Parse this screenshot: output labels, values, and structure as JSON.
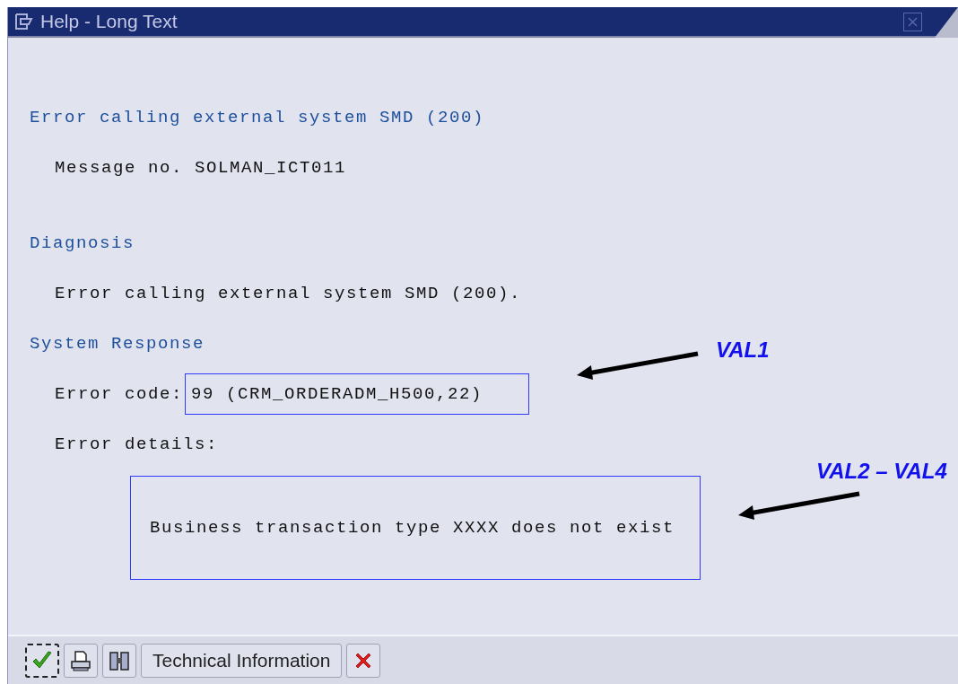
{
  "window": {
    "title": "Help - Long Text"
  },
  "sections": [
    {
      "heading": "Error calling external system SMD (200)",
      "lines": [
        {
          "kind": "text",
          "text": "Message no. SOLMAN_ICT011"
        }
      ]
    },
    {
      "heading": "Diagnosis",
      "lines": [
        {
          "kind": "text",
          "text": "Error calling external system SMD (200)."
        }
      ]
    },
    {
      "heading": "System Response",
      "lines": [
        {
          "kind": "field",
          "label": "Error code:",
          "value": "99 (CRM_ORDERADM_H500,22)"
        },
        {
          "kind": "text",
          "text": "Error details:"
        },
        {
          "kind": "box",
          "text": "Business transaction type XXXX does not exist"
        }
      ]
    }
  ],
  "annotations": [
    {
      "label": "VAL1"
    },
    {
      "label": "VAL2 – VAL4"
    }
  ],
  "toolbar": [
    {
      "kind": "check",
      "focused": true
    },
    {
      "kind": "print",
      "focused": false
    },
    {
      "kind": "find",
      "focused": false
    },
    {
      "kind": "text",
      "label": "Technical Information",
      "focused": false
    },
    {
      "kind": "cancel",
      "focused": false
    }
  ]
}
